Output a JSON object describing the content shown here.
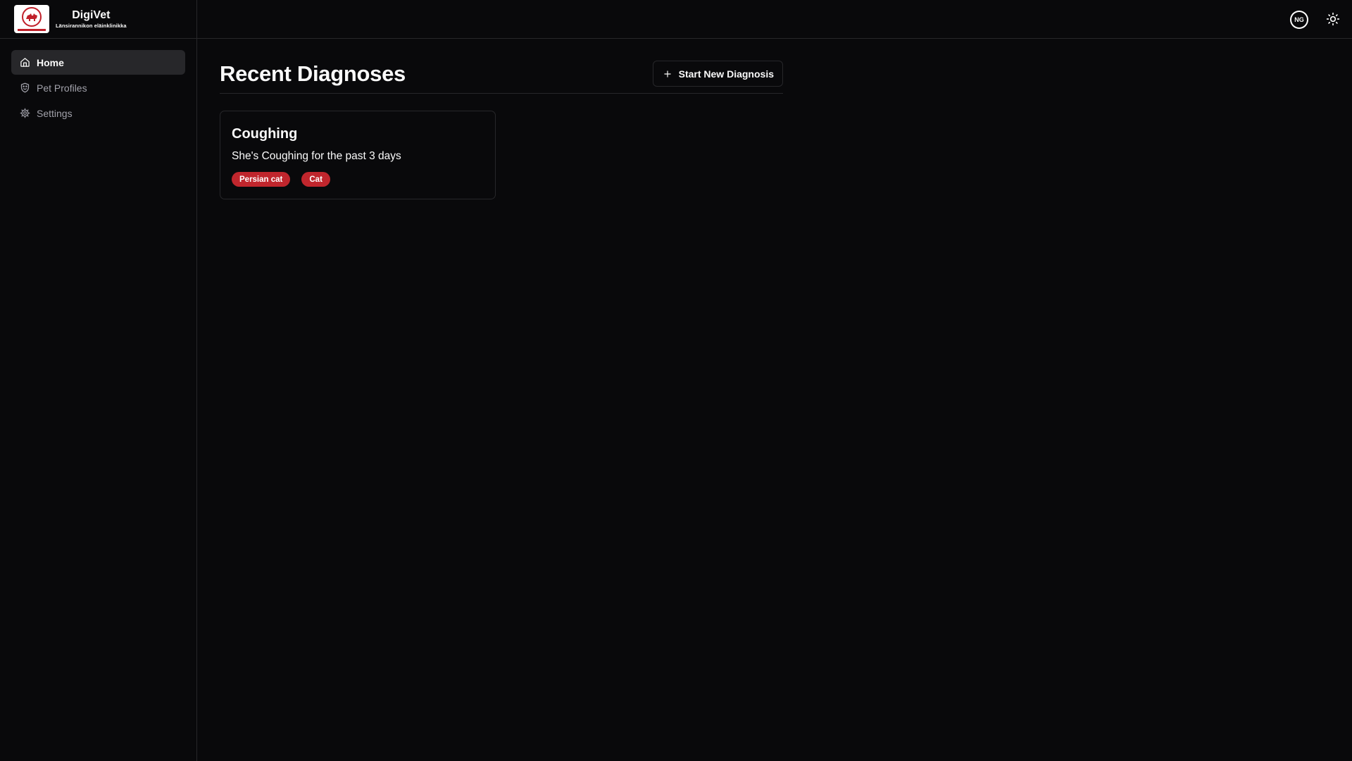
{
  "brand": {
    "name": "DigiVet",
    "subtitle": "Länsirannikon eläinklinikka",
    "logo_icon": "animal-clinic-logo"
  },
  "sidebar": {
    "items": [
      {
        "label": "Home",
        "icon": "home-icon",
        "active": true
      },
      {
        "label": "Pet Profiles",
        "icon": "shield-paw-icon",
        "active": false
      },
      {
        "label": "Settings",
        "icon": "gear-icon",
        "active": false
      }
    ]
  },
  "header": {
    "avatar_initials": "NG",
    "theme_toggle_icon": "sun-icon"
  },
  "main": {
    "title": "Recent Diagnoses",
    "new_button_label": "Start New Diagnosis",
    "cards": [
      {
        "title": "Coughing",
        "description": "She's Coughing for the past 3 days",
        "tags": [
          "Persian cat",
          "Cat"
        ]
      }
    ]
  },
  "colors": {
    "background": "#09090b",
    "border": "#27272a",
    "tag": "#c0262d",
    "text": "#fafafa",
    "muted_text": "#a1a1aa"
  }
}
